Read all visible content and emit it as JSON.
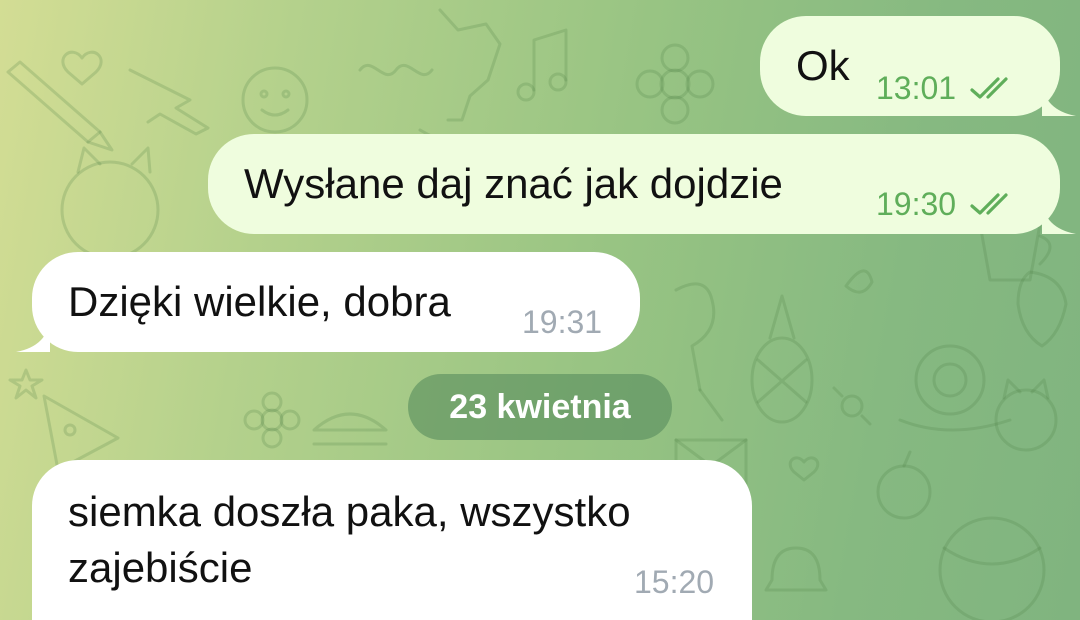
{
  "chat": {
    "messages": [
      {
        "direction": "outgoing",
        "text": "Ok",
        "time": "13:01",
        "status": "read"
      },
      {
        "direction": "outgoing",
        "text": "Wysłane daj znać jak dojdzie",
        "time": "19:30",
        "status": "read"
      },
      {
        "direction": "incoming",
        "text": "Dzięki wielkie, dobra",
        "time": "19:31"
      },
      {
        "direction": "incoming",
        "text_lines": [
          "siemka doszła paka, wszystko",
          "zajebiście"
        ],
        "time": "15:20"
      }
    ],
    "date_separator": "23 kwietnia"
  },
  "icons": {
    "read_status": "double-check-icon"
  },
  "colors": {
    "outgoing_bubble": "#effdde",
    "incoming_bubble": "#ffffff",
    "outgoing_meta": "#5fae5a",
    "incoming_meta": "#a1aab3",
    "date_pill": "#548a5c",
    "background_start": "#d3dd94",
    "background_end": "#80b47f"
  }
}
